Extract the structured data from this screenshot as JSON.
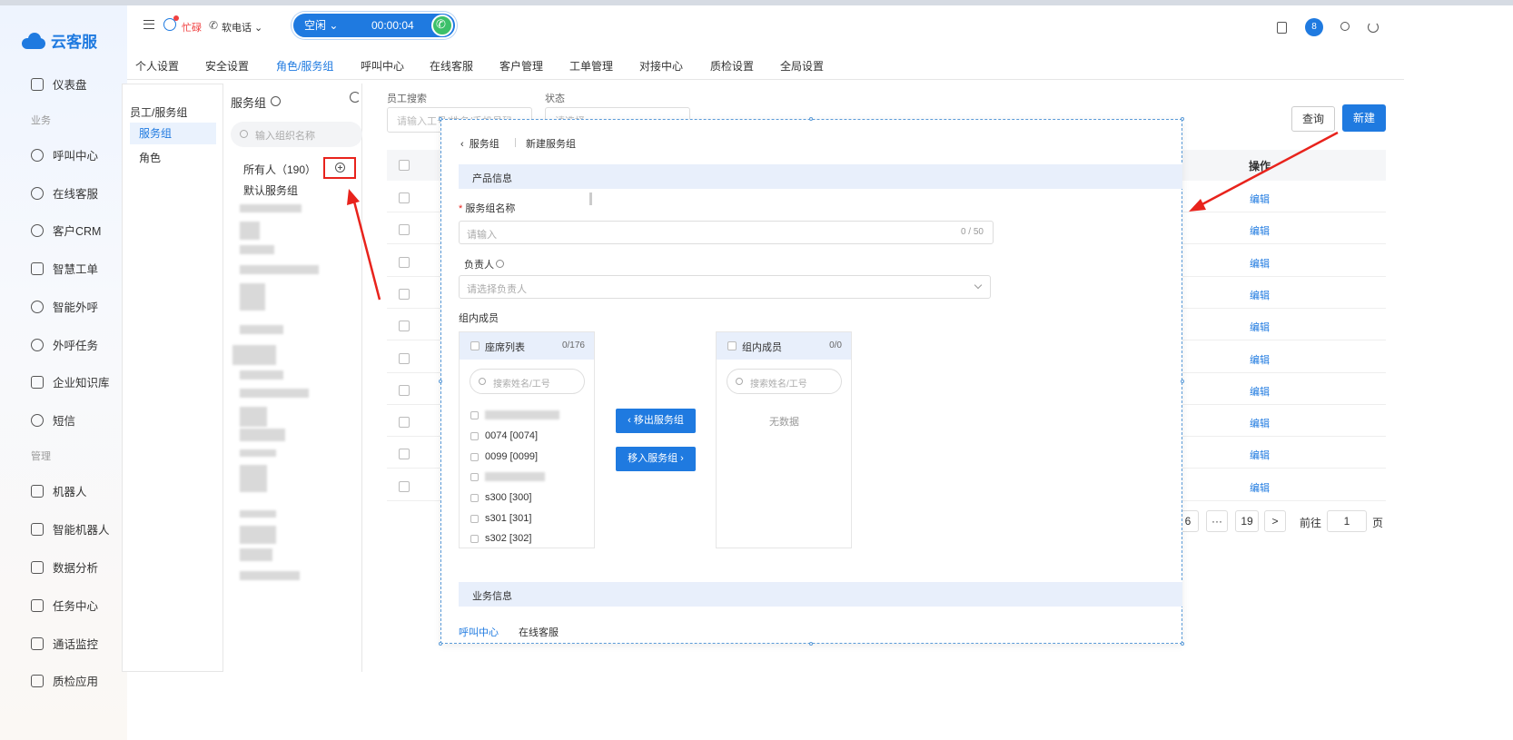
{
  "app": {
    "logo_text": "云客服"
  },
  "sidebar": {
    "items": [
      {
        "label": "仪表盘",
        "icon": "home-icon"
      },
      {
        "label": "呼叫中心",
        "icon": "phone-icon"
      },
      {
        "label": "在线客服",
        "icon": "headset-icon"
      },
      {
        "label": "客户CRM",
        "icon": "user-icon"
      },
      {
        "label": "智慧工单",
        "icon": "ticket-icon"
      },
      {
        "label": "智能外呼",
        "icon": "whatsapp-icon"
      },
      {
        "label": "外呼任务",
        "icon": "call-list-icon"
      },
      {
        "label": "企业知识库",
        "icon": "book-icon"
      },
      {
        "label": "短信",
        "icon": "sms-icon"
      },
      {
        "label": "机器人",
        "icon": "robot-icon"
      },
      {
        "label": "智能机器人",
        "icon": "ai-robot-icon"
      },
      {
        "label": "数据分析",
        "icon": "chart-icon"
      },
      {
        "label": "任务中心",
        "icon": "task-icon"
      },
      {
        "label": "通话监控",
        "icon": "monitor-icon"
      },
      {
        "label": "质检应用",
        "icon": "qc-icon"
      }
    ],
    "sections": {
      "business": "业务",
      "manage": "管理"
    }
  },
  "topbar": {
    "status_label": "忙碌",
    "phone_label": "软电话",
    "call_state": "空闲",
    "call_timer": "00:00:04",
    "notification_count": "8"
  },
  "tabs": [
    "个人设置",
    "安全设置",
    "角色/服务组",
    "呼叫中心",
    "在线客服",
    "客户管理",
    "工单管理",
    "对接中心",
    "质检设置",
    "全局设置"
  ],
  "subnav": {
    "header": "员工/服务组",
    "active": "服务组",
    "item": "角色"
  },
  "groups": {
    "title": "服务组",
    "search_placeholder": "输入组织名称",
    "all_label": "所有人（190）",
    "default_group": "默认服务组"
  },
  "filter": {
    "staff_search_label": "员工搜索",
    "staff_search_placeholder": "请输入工号/姓名/手机号码",
    "status_label": "状态",
    "status_placeholder": "请选择",
    "query_button": "查询",
    "new_button": "新建"
  },
  "table": {
    "operation_header": "操作",
    "edit_label": "编辑",
    "rows": 10
  },
  "pagination": {
    "page_partial": "6",
    "ellipsis": "···",
    "last_page": "19",
    "next": ">",
    "goto_label": "前往",
    "goto_value": "1",
    "page_suffix": "页"
  },
  "modal": {
    "back_label": "服务组",
    "breadcrumb": "新建服务组",
    "product_section": "产品信息",
    "name_label": "服务组名称",
    "name_placeholder": "请输入",
    "name_count": "0 / 50",
    "owner_label": "负责人",
    "owner_placeholder": "请选择负责人",
    "members_label": "组内成员",
    "left_list": {
      "title": "座席列表",
      "count": "0/176",
      "search_placeholder": "搜索姓名/工号",
      "items": [
        "0074 [0074]",
        "0099 [0099]",
        "s300 [300]",
        "s301 [301]",
        "s302 [302]"
      ]
    },
    "right_list": {
      "title": "组内成员",
      "count": "0/0",
      "search_placeholder": "搜索姓名/工号",
      "empty": "无数据"
    },
    "move_out_button": "移出服务组",
    "move_in_button": "移入服务组",
    "business_section": "业务信息",
    "business_tabs": [
      "呼叫中心",
      "在线客服"
    ]
  },
  "colors": {
    "accent": "#1f7ae0",
    "danger": "#e8231c",
    "answer": "#3cc06a"
  }
}
